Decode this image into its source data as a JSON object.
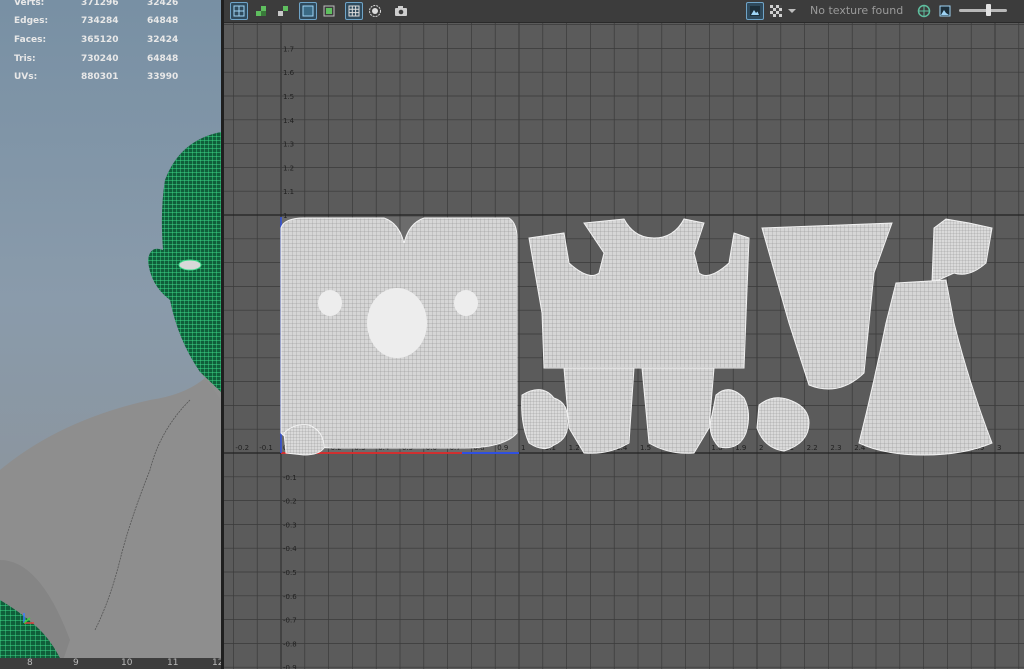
{
  "scene_stats": {
    "rows": [
      {
        "label": "Verts:",
        "total": "371296",
        "selected": "32426"
      },
      {
        "label": "Edges:",
        "total": "734284",
        "selected": "64848"
      },
      {
        "label": "Faces:",
        "total": "365120",
        "selected": "32424"
      },
      {
        "label": "Tris:",
        "total": "730240",
        "selected": "64848"
      },
      {
        "label": "UVs:",
        "total": "880301",
        "selected": "33990"
      }
    ]
  },
  "viewport": {
    "ruler_ticks": [
      "8",
      "9",
      "10",
      "11",
      "12"
    ],
    "wireframe_color": "#3ddc8a",
    "mesh_color": "#8e8e8e",
    "background_color": "#8a9bab"
  },
  "uv_toolbar": {
    "texture_status": "No texture found",
    "buttons": [
      {
        "name": "uv-shell-border-icon",
        "active": true
      },
      {
        "name": "uv-distortion-icon",
        "active": false
      },
      {
        "name": "uv-texture-borders-icon",
        "active": false
      },
      {
        "name": "uv-display-image-icon",
        "active": true
      },
      {
        "name": "uv-dim-image-icon",
        "active": false
      },
      {
        "name": "uv-grid-icon",
        "active": true
      },
      {
        "name": "uv-shaded-icon",
        "active": false
      },
      {
        "name": "uv-snapshot-icon",
        "active": false
      },
      {
        "name": "display-image-toggle-icon",
        "active": true
      },
      {
        "name": "checker-tiles-icon",
        "active": false
      },
      {
        "name": "checker-options-chevron-icon",
        "active": false
      },
      {
        "name": "color-management-icon",
        "active": false
      },
      {
        "name": "image-channels-icon",
        "active": false
      }
    ],
    "exposure_level": 0.6
  },
  "uv_grid": {
    "x_labels": [
      "-0.2",
      "-0.1",
      "0",
      "0.1",
      "0.2",
      "0.3",
      "0.4",
      "0.5",
      "0.6",
      "0.7",
      "0.8",
      "0.9",
      "1",
      "1.1",
      "1.2",
      "1.3",
      "1.4",
      "1.5",
      "1.6",
      "1.7",
      "1.8",
      "1.9",
      "2",
      "2.1",
      "2.2",
      "2.3",
      "2.4",
      "2.5",
      "2.6",
      "2.7",
      "2.8",
      "2.9",
      "3"
    ],
    "y_labels": [
      "1.7",
      "1.6",
      "1.5",
      "1.4",
      "1.3",
      "1.2",
      "1.1",
      "1",
      "-0.1",
      "-0.2",
      "-0.3",
      "-0.4",
      "-0.5",
      "-0.6",
      "-0.7",
      "-0.8",
      "-0.9"
    ],
    "background_color": "#5b5b5b",
    "tile_color": "#6c6c6c",
    "grid_color": "#3a3a3a",
    "shell_color": "#e6e6e6"
  }
}
